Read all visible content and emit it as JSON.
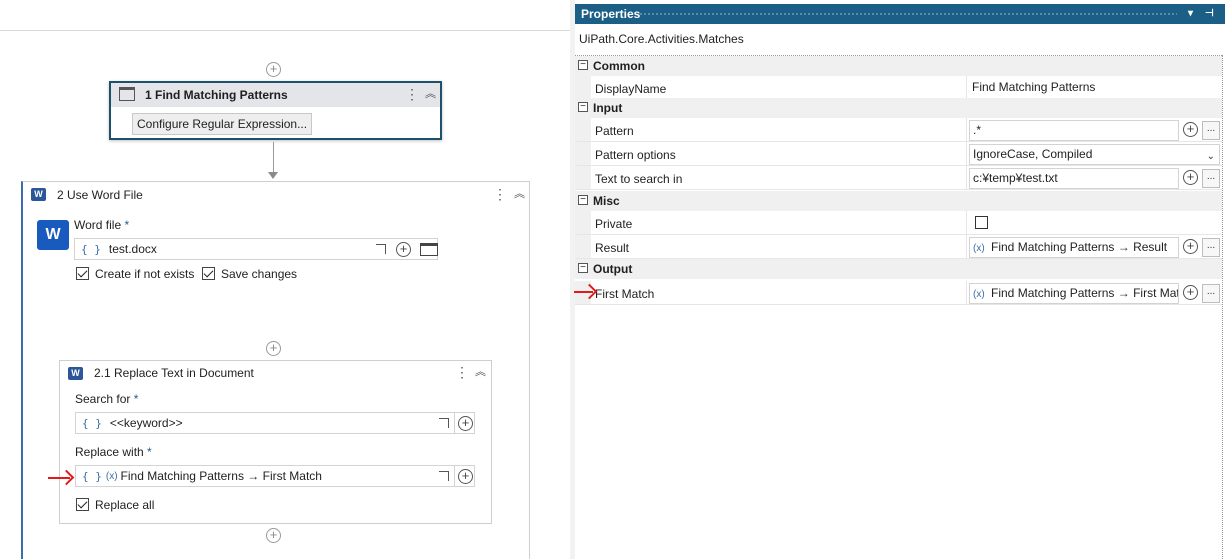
{
  "designer": {
    "find_activity": {
      "title": "1  Find Matching Patterns",
      "configure_button": "Configure Regular Expression..."
    },
    "word_activity": {
      "title": "2  Use Word File",
      "word_file_label": "Word file",
      "required_mark": "*",
      "word_file_value": "test.docx",
      "create_if_not_exists": {
        "label": "Create if not exists",
        "checked": true
      },
      "save_changes": {
        "label": "Save changes",
        "checked": true
      }
    },
    "replace_activity": {
      "title": "2.1  Replace Text in Document",
      "search_for_label": "Search for",
      "search_for_value": "<<keyword>>",
      "replace_with_label": "Replace with",
      "replace_with_value": "Find Matching Patterns → First Match",
      "replace_all": {
        "label": "Replace all",
        "checked": true
      }
    },
    "brace_glyph": "{ }",
    "expr_glyph": "(x)",
    "kebab_glyph": "⋮",
    "collapse_glyph": "︽",
    "plus_glyph": "+",
    "word_letter": "W"
  },
  "properties": {
    "title": "Properties",
    "type_name": "UiPath.Core.Activities.Matches",
    "categories": {
      "common": "Common",
      "input": "Input",
      "misc": "Misc",
      "output": "Output"
    },
    "toggle_glyph": "−",
    "rows": {
      "display_name": {
        "name": "DisplayName",
        "value": "Find Matching Patterns"
      },
      "pattern": {
        "name": "Pattern",
        "value": ".*"
      },
      "pattern_options": {
        "name": "Pattern options",
        "value": "IgnoreCase, Compiled"
      },
      "text_to_search": {
        "name": "Text to search in",
        "value": "c:¥temp¥test.txt"
      },
      "private": {
        "name": "Private",
        "checked": false
      },
      "result": {
        "name": "Result",
        "value": "Find Matching Patterns → Result"
      },
      "first_match": {
        "name": "First Match",
        "value": "Find Matching Patterns → First Match"
      }
    },
    "ellipsis_glyph": "...",
    "chevron_glyph": "⌄",
    "pin_glyph": "⊣",
    "dropdown_glyph": "▾"
  },
  "colors": {
    "title_bar": "#1b5f86",
    "selected_border": "#1e4f6b",
    "annotation_arrow": "#e01b1b",
    "word_blue": "#185abd"
  }
}
